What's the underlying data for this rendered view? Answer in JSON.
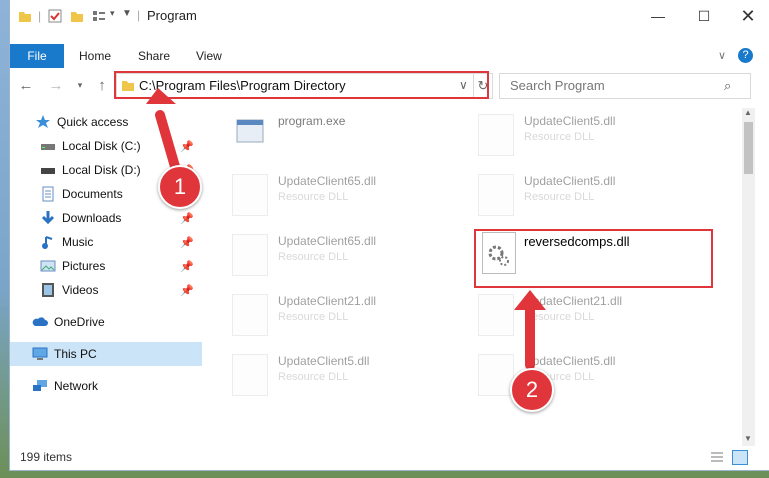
{
  "window": {
    "title": "Program"
  },
  "ribbon": {
    "tabs": [
      "File",
      "Home",
      "Share",
      "View"
    ]
  },
  "address": {
    "path": "C:\\Program Files\\Program Directory"
  },
  "search": {
    "placeholder": "Search Program"
  },
  "sidebar": {
    "items": [
      {
        "label": "Quick access",
        "icon": "star-icon"
      },
      {
        "label": "Local Disk (C:)",
        "icon": "drive-icon",
        "pinned": true
      },
      {
        "label": "Local Disk (D:)",
        "icon": "drive-icon",
        "pinned": true
      },
      {
        "label": "Documents",
        "icon": "documents-icon",
        "pinned": true
      },
      {
        "label": "Downloads",
        "icon": "downloads-icon",
        "pinned": true
      },
      {
        "label": "Music",
        "icon": "music-icon",
        "pinned": true
      },
      {
        "label": "Pictures",
        "icon": "pictures-icon",
        "pinned": true
      },
      {
        "label": "Videos",
        "icon": "videos-icon",
        "pinned": true
      },
      {
        "label": "OneDrive",
        "icon": "cloud-icon"
      },
      {
        "label": "This PC",
        "icon": "computer-icon",
        "selected": true
      },
      {
        "label": "Network",
        "icon": "network-icon"
      }
    ]
  },
  "files": [
    {
      "name": "program.exe",
      "type": ""
    },
    {
      "name": "UpdateClient5.dll",
      "type": "Resource DLL"
    },
    {
      "name": "UpdateClient65.dll",
      "type": "Resource DLL"
    },
    {
      "name": "UpdateClient5.dll",
      "type": "Resource DLL"
    },
    {
      "name": "UpdateClient65.dll",
      "type": "Resource DLL"
    },
    {
      "name": "reversedcomps.dll",
      "type": ""
    },
    {
      "name": "UpdateClient21.dll",
      "type": "Resource DLL"
    },
    {
      "name": "UpdateClient21.dll",
      "type": "Resource DLL"
    },
    {
      "name": "UpdateClient5.dll",
      "type": "Resource DLL"
    },
    {
      "name": "UpdateClient5.dll",
      "type": "Resource DLL"
    }
  ],
  "status": {
    "item_count": "199 items"
  },
  "annotations": {
    "step1": "1",
    "step2": "2"
  },
  "colors": {
    "accent": "#1979ca",
    "highlight": "#e0353a"
  }
}
